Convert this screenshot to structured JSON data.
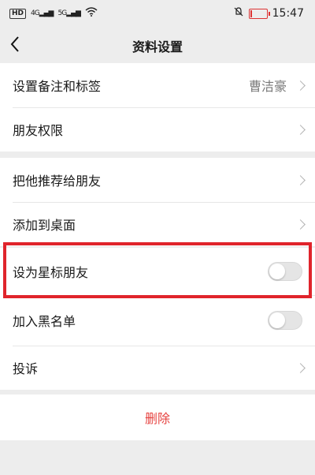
{
  "status_bar": {
    "hd_badge": "HD",
    "signal1": "4G",
    "signal2": "5G",
    "battery_level": 9,
    "time": "15:47"
  },
  "nav": {
    "title": "资料设置",
    "back_icon": "chevron-left-icon"
  },
  "group1": [
    {
      "label": "设置备注和标签",
      "value": "曹洁豪"
    },
    {
      "label": "朋友权限",
      "value": ""
    }
  ],
  "group2": [
    {
      "label": "把他推荐给朋友"
    },
    {
      "label": "添加到桌面"
    }
  ],
  "group3": [
    {
      "label": "设为星标朋友",
      "toggle_on": false
    },
    {
      "label": "加入黑名单",
      "toggle_on": false
    },
    {
      "label": "投诉"
    }
  ],
  "delete_label": "删除",
  "colors": {
    "highlight": "#e0242b",
    "danger": "#e64340",
    "background": "#ededed"
  }
}
